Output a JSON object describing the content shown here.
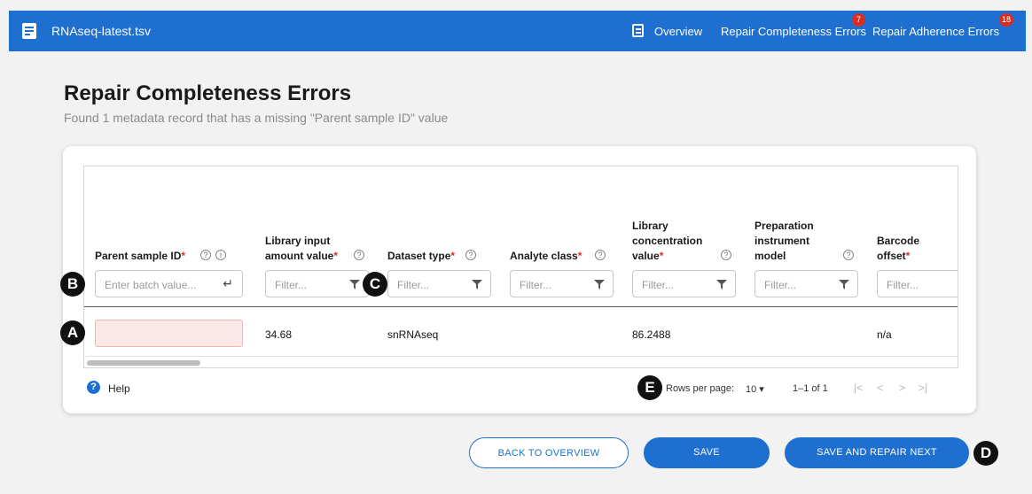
{
  "header": {
    "file_name": "RNAseq-latest.tsv",
    "nav": [
      {
        "label": "Overview"
      },
      {
        "label": "Repair Completeness Errors",
        "badge": "7"
      },
      {
        "label": "Repair Adherence Errors",
        "badge": "18"
      }
    ]
  },
  "page": {
    "title": "Repair Completeness Errors",
    "subtitle": "Found 1 metadata record that has a missing \"Parent sample ID\" value"
  },
  "table": {
    "columns": [
      {
        "title": "Parent sample ID",
        "required": true
      },
      {
        "title": "Library input amount value",
        "required": true
      },
      {
        "title": "Dataset type",
        "required": true
      },
      {
        "title": "Analyte class",
        "required": true
      },
      {
        "title": "Library concentration value",
        "required": true
      },
      {
        "title": "Preparation instrument model",
        "required": false
      },
      {
        "title": "Barcode offset",
        "required": true
      }
    ],
    "required_marker": "*",
    "help_glyph": "?",
    "info_glyph": "i",
    "batch_placeholder": "Enter batch value...",
    "filter_placeholder": "Filter...",
    "rows": [
      [
        "",
        "34.68",
        "snRNAseq",
        "",
        "86.2488",
        "",
        "n/a"
      ]
    ]
  },
  "footer": {
    "help_label": "Help",
    "rows_per_page_label": "Rows per page:",
    "rows_per_page_value": "10",
    "range_text": "1–1 of 1"
  },
  "actions": {
    "back": "BACK TO OVERVIEW",
    "save": "SAVE",
    "save_next": "SAVE AND REPAIR NEXT"
  },
  "callouts": {
    "a": "A",
    "b": "B",
    "c": "C",
    "d": "D",
    "e": "E"
  },
  "colors": {
    "primary": "#1e6fd0",
    "required": "#d32f2f",
    "missing_cell": "#fde8e8",
    "badge": "#d92d20"
  }
}
